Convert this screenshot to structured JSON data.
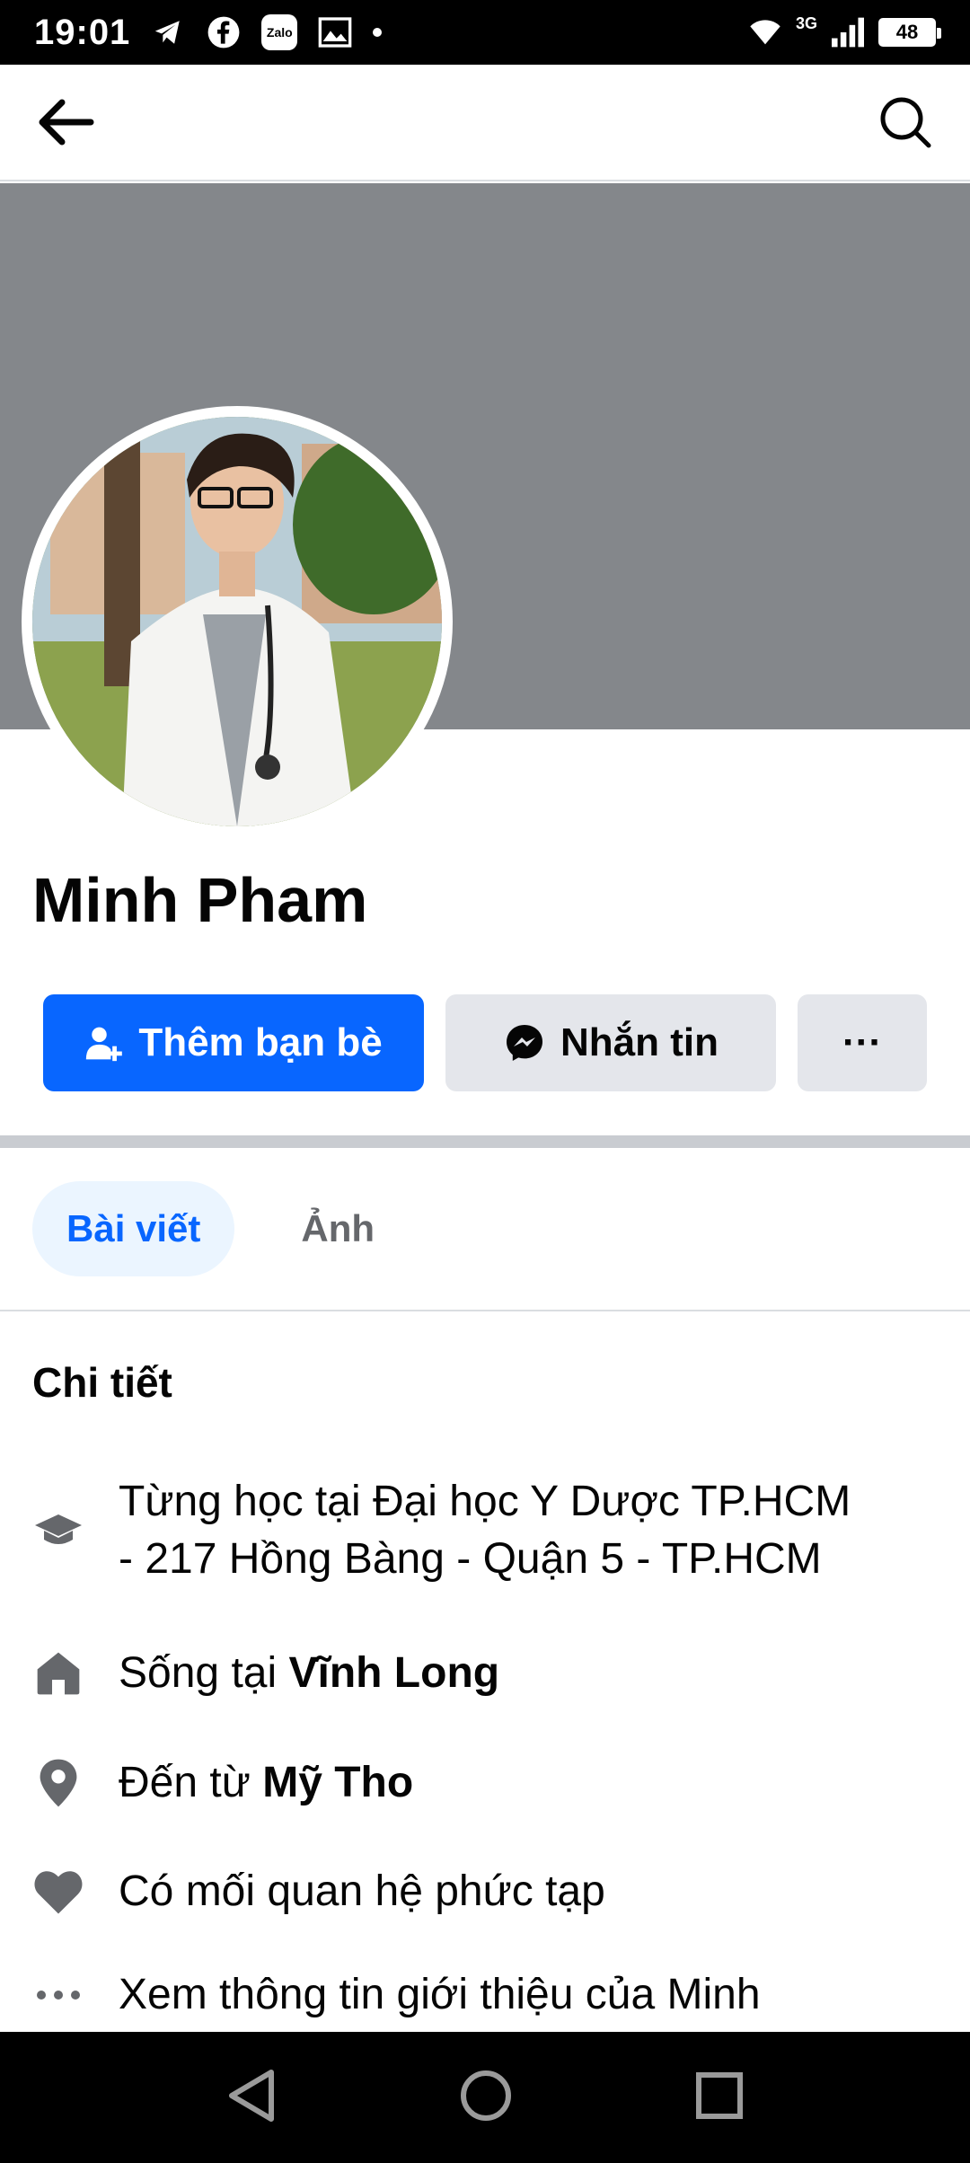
{
  "status_bar": {
    "time": "19:01",
    "icons": [
      "telegram-icon",
      "facebook-icon",
      "zalo-icon",
      "gallery-icon"
    ],
    "zalo_label": "Zalo",
    "network_label": "3G",
    "battery": "48"
  },
  "nav": {
    "back_icon": "arrow-left-icon",
    "search_icon": "search-icon"
  },
  "profile": {
    "name": "Minh Pham"
  },
  "actions": {
    "add_friend": "Thêm bạn bè",
    "message": "Nhắn tin",
    "more": "···"
  },
  "tabs": [
    {
      "label": "Bài viết",
      "active": true
    },
    {
      "label": "Ảnh",
      "active": false
    }
  ],
  "details": {
    "title": "Chi tiết",
    "education_line1": "Từng học tại Đại học Y Dược TP.HCM",
    "education_line2": "- 217 Hồng Bàng - Quận 5 - TP.HCM",
    "lives_prefix": "Sống tại ",
    "lives_place": "Vĩnh Long",
    "from_prefix": "Đến từ ",
    "from_place": "Mỹ Tho",
    "relationship": "Có mối quan hệ phức tạp",
    "see_about": "Xem thông tin giới thiệu của Minh"
  },
  "colors": {
    "primary": "#0866ff",
    "secondary_button": "#e4e6eb",
    "cover": "#84878b",
    "active_tab_bg": "#ebf5ff",
    "icon_gray": "#65676b"
  }
}
